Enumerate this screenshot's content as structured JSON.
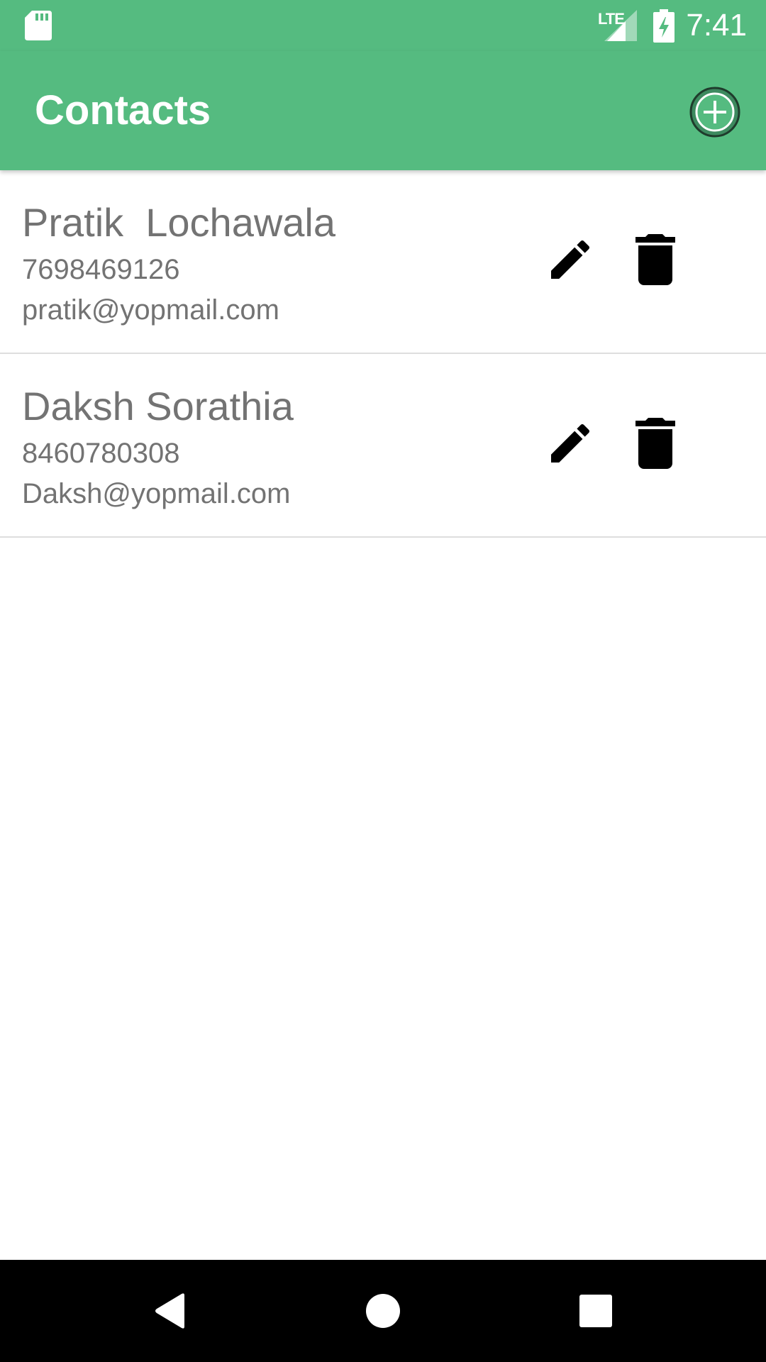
{
  "status_bar": {
    "time": "7:41",
    "network": "LTE",
    "icons": [
      "sd-card-icon",
      "lte-signal-icon",
      "battery-charging-icon"
    ]
  },
  "app_bar": {
    "title": "Contacts",
    "add_icon": "add-circle-icon"
  },
  "contacts": [
    {
      "name": "Pratik  Lochawala",
      "phone": "7698469126",
      "email": "pratik@yopmail.com"
    },
    {
      "name": "Daksh Sorathia",
      "phone": "8460780308",
      "email": "Daksh@yopmail.com"
    }
  ],
  "row_icons": {
    "edit": "edit-icon",
    "delete": "delete-icon"
  },
  "nav_bar": {
    "icons": [
      "back-icon",
      "home-icon",
      "recents-icon"
    ]
  },
  "colors": {
    "primary": "#55bb80",
    "text_secondary": "#737373",
    "icon": "#000000",
    "divider": "#dedede",
    "nav_background": "#000000"
  }
}
